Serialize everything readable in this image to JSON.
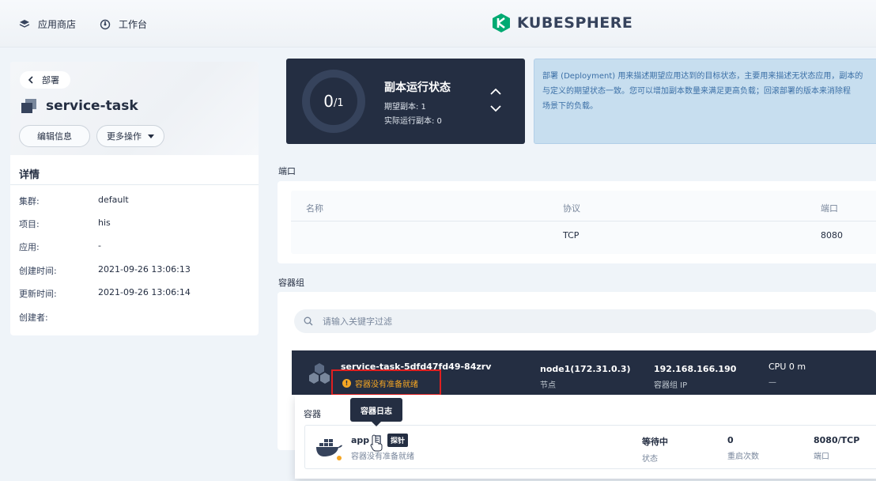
{
  "nav": {
    "app_store": "应用商店",
    "workbench": "工作台",
    "brand": "KUBESPHERE"
  },
  "detail": {
    "back_label": "部署",
    "name": "service-task",
    "edit_button": "编辑信息",
    "more_button": "更多操作",
    "section_title": "详情",
    "fields": [
      {
        "label": "集群:",
        "value": "default"
      },
      {
        "label": "项目:",
        "value": "his"
      },
      {
        "label": "应用:",
        "value": "-"
      },
      {
        "label": "创建时间:",
        "value": "2021-09-26 13:06:13"
      },
      {
        "label": "更新时间:",
        "value": "2021-09-26 13:06:14"
      },
      {
        "label": "创建者:",
        "value": ""
      }
    ]
  },
  "replica": {
    "ready": "0",
    "total": "/1",
    "title": "副本运行状态",
    "desired": "期望副本: 1",
    "actual": "实际运行副本: 0"
  },
  "info": {
    "line1": "部署 (Deployment) 用来描述期望应用达到的目标状态，主要用来描述无状态应用，副本的",
    "line2": "与定义的期望状态一致。您可以增加副本数量来满足更高负载；回滚部署的版本来消除程",
    "line3": "场景下的负载。"
  },
  "ports": {
    "section_label": "端口",
    "headers": {
      "name": "名称",
      "protocol": "协议",
      "port": "端口"
    },
    "rows": [
      {
        "name": "",
        "protocol": "TCP",
        "port": "8080"
      }
    ]
  },
  "pods": {
    "section_label": "容器组",
    "search_placeholder": "请输入关键字过滤",
    "pod": {
      "name": "service-task-5dfd47fd49-84zrv",
      "status": "容器没有准备就绪",
      "node": "node1(172.31.0.3)",
      "node_label": "节点",
      "ip": "192.168.166.190",
      "ip_label": "容器组 IP",
      "cpu": "CPU 0 m",
      "cpu_sub": "—"
    },
    "containers_label": "容器",
    "tooltip": "容器日志",
    "container": {
      "name": "app",
      "probe_badge": "探针",
      "sub": "容器没有准备就绪",
      "state": "等待中",
      "state_label": "状态",
      "restarts": "0",
      "restarts_label": "重启次数",
      "ports": "8080/TCP",
      "ports_label": "端口"
    }
  }
}
